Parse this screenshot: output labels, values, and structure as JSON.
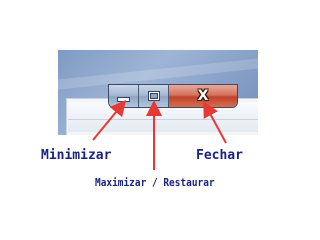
{
  "window": {
    "caption_buttons": [
      {
        "name": "minimize",
        "icon": "minimize-icon"
      },
      {
        "name": "maximize-restore",
        "icon": "maximize-icon"
      },
      {
        "name": "close",
        "icon": "close-icon",
        "glyph": "X"
      }
    ]
  },
  "annotations": {
    "minimize_label": "Minimizar",
    "maximize_label": "Maximizar / Restaurar",
    "close_label": "Fechar",
    "arrow_color": "#e53935",
    "label_color": "#1a237e"
  }
}
